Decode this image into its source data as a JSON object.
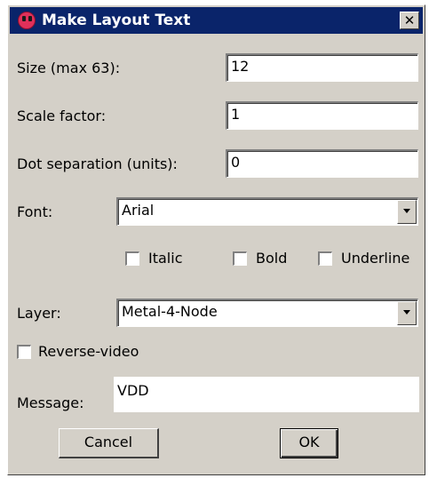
{
  "window": {
    "title": "Make Layout Text"
  },
  "fields": {
    "size_label": "Size (max 63):",
    "size_value": "12",
    "scale_label": "Scale factor:",
    "scale_value": "1",
    "dot_label": "Dot separation (units):",
    "dot_value": "0",
    "font_label": "Font:",
    "font_value": "Arial",
    "italic_label": "Italic",
    "bold_label": "Bold",
    "underline_label": "Underline",
    "italic_checked": false,
    "bold_checked": false,
    "underline_checked": false,
    "layer_label": "Layer:",
    "layer_value": "Metal-4-Node",
    "reverse_label": "Reverse-video",
    "reverse_checked": false,
    "message_label": "Message:",
    "message_value": "VDD"
  },
  "buttons": {
    "cancel": "Cancel",
    "ok": "OK"
  }
}
